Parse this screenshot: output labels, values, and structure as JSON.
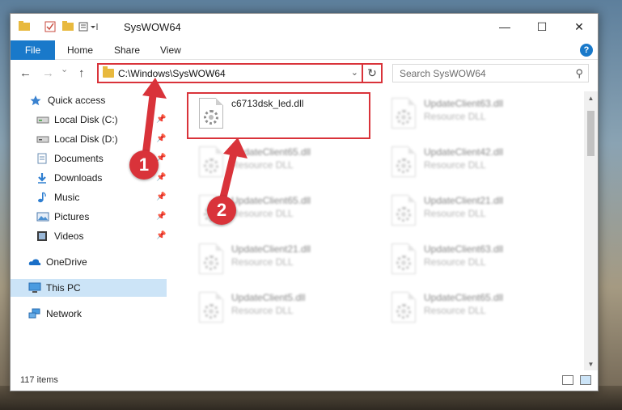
{
  "window": {
    "title": "SysWOW64",
    "minimize_glyph": "—",
    "maximize_glyph": "☐",
    "close_glyph": "✕"
  },
  "ribbon": {
    "tabs": [
      "File",
      "Home",
      "Share",
      "View"
    ],
    "help": "?"
  },
  "nav": {
    "back_glyph": "←",
    "forward_glyph": "→",
    "recent_glyph": "⌄",
    "up_glyph": "↑",
    "address": "C:\\Windows\\SysWOW64",
    "refresh_glyph": "↻",
    "dropdown_glyph": "⌄",
    "search_placeholder": "Search SysWOW64",
    "search_glyph": "⚲"
  },
  "sidebar": {
    "items": [
      {
        "label": "Quick access",
        "icon": "star-icon",
        "pinned": false
      },
      {
        "label": "Local Disk (C:)",
        "icon": "drive-icon",
        "pinned": true
      },
      {
        "label": "Local Disk (D:)",
        "icon": "drive-icon",
        "pinned": true
      },
      {
        "label": "Documents",
        "icon": "documents-icon",
        "pinned": true
      },
      {
        "label": "Downloads",
        "icon": "download-icon",
        "pinned": true
      },
      {
        "label": "Music",
        "icon": "music-icon",
        "pinned": true
      },
      {
        "label": "Pictures",
        "icon": "pictures-icon",
        "pinned": true
      },
      {
        "label": "Videos",
        "icon": "videos-icon",
        "pinned": true
      },
      {
        "label": "OneDrive",
        "icon": "cloud-icon",
        "pinned": false
      },
      {
        "label": "This PC",
        "icon": "computer-icon",
        "pinned": false,
        "selected": true
      },
      {
        "label": "Network",
        "icon": "network-icon",
        "pinned": false
      }
    ],
    "pin_glyph": "📌"
  },
  "files": [
    {
      "name": "c6713dsk_led.dll",
      "type": "",
      "highlighted": true
    },
    {
      "name": "UpdateClient63.dll",
      "type": "Resource DLL"
    },
    {
      "name": "UpdateClient65.dll",
      "type": "Resource DLL"
    },
    {
      "name": "UpdateClient42.dll",
      "type": "Resource DLL"
    },
    {
      "name": "UpdateClient65.dll",
      "type": "Resource DLL"
    },
    {
      "name": "UpdateClient21.dll",
      "type": "Resource DLL"
    },
    {
      "name": "UpdateClient21.dll",
      "type": "Resource DLL"
    },
    {
      "name": "UpdateClient63.dll",
      "type": "Resource DLL"
    },
    {
      "name": "UpdateClient5.dll",
      "type": "Resource DLL"
    },
    {
      "name": "UpdateClient65.dll",
      "type": "Resource DLL"
    }
  ],
  "status": {
    "item_count": "117 items"
  },
  "annotations": {
    "step1": "1",
    "step2": "2"
  },
  "colors": {
    "accent": "#1979ca",
    "highlight": "#d9333a",
    "selected": "#cce4f7"
  }
}
